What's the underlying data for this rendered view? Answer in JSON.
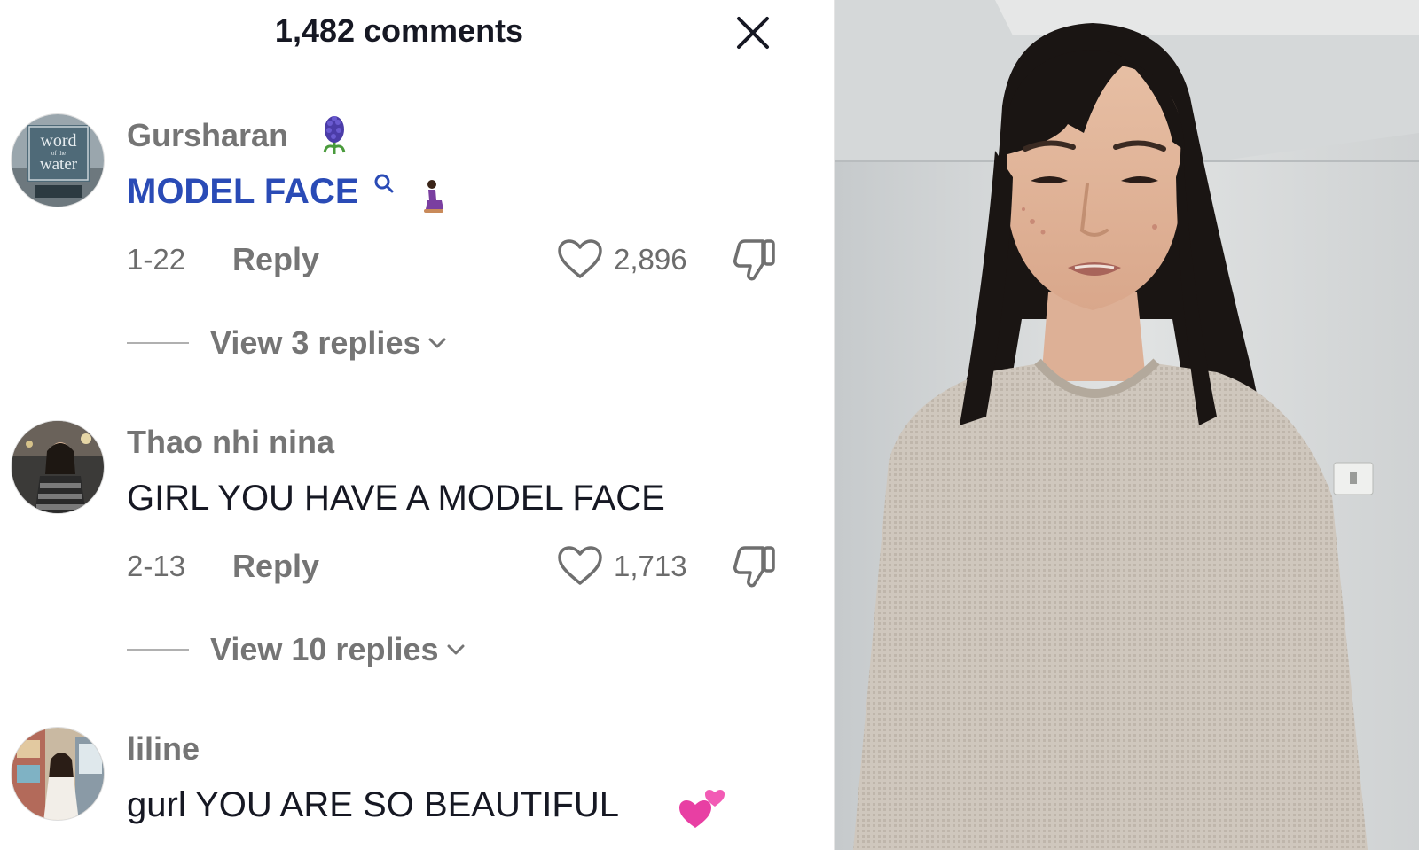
{
  "header": {
    "title": "1,482 comments"
  },
  "comments": [
    {
      "username": "Gursharan",
      "username_emoji": "hyacinth",
      "text": "MODEL FACE",
      "text_is_search_link": true,
      "trailing_emoji": "kneeling-woman",
      "date": "1-22",
      "reply_label": "Reply",
      "likes": "2,896",
      "view_replies": "View 3 replies",
      "avatar_text": [
        "word",
        "of the",
        "water"
      ]
    },
    {
      "username": "Thao nhi nina",
      "text": "GIRL YOU HAVE A MODEL FACE",
      "date": "2-13",
      "reply_label": "Reply",
      "likes": "1,713",
      "view_replies": "View 10 replies"
    },
    {
      "username": "liline",
      "text": "gurl YOU ARE SO BEAUTIFUL",
      "trailing_emoji": "two-hearts"
    }
  ],
  "colors": {
    "link_blue": "#2a4bb6",
    "muted_gray": "#757575",
    "text_dark": "#161823"
  }
}
